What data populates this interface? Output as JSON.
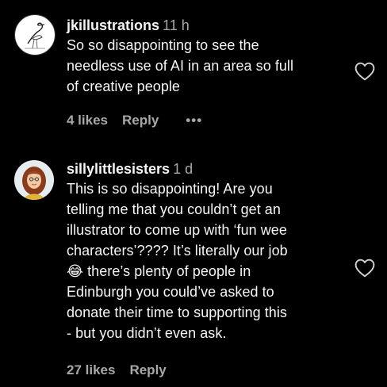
{
  "comments": [
    {
      "username": "jkillustrations",
      "time": "11 h",
      "lines": [
        "So so disappointing to see the",
        "needless use of AI in an area so full",
        "of creative people"
      ],
      "likes": "4 likes",
      "reply": "Reply",
      "more": "•••",
      "avatar_icon": "heron-sketch-icon"
    },
    {
      "username": "sillylittlesisters",
      "time": "1 d",
      "lines": [
        "This is so disappointing! Are you",
        "telling me that you couldn’t get an",
        "illustrator to come up with ‘fun wee",
        "characters’???? It’s literally our job",
        "😂 there’s plenty of people in",
        "Edinburgh you could’ve asked to",
        "donate their time to supporting this",
        "- but you didn’t even ask."
      ],
      "likes": "27 likes",
      "reply": "Reply",
      "avatar_icon": "illustrated-woman-avatar"
    }
  ],
  "colors": {
    "background": "#000000",
    "text": "#f5f5f5",
    "secondary": "#a8a8a8"
  }
}
